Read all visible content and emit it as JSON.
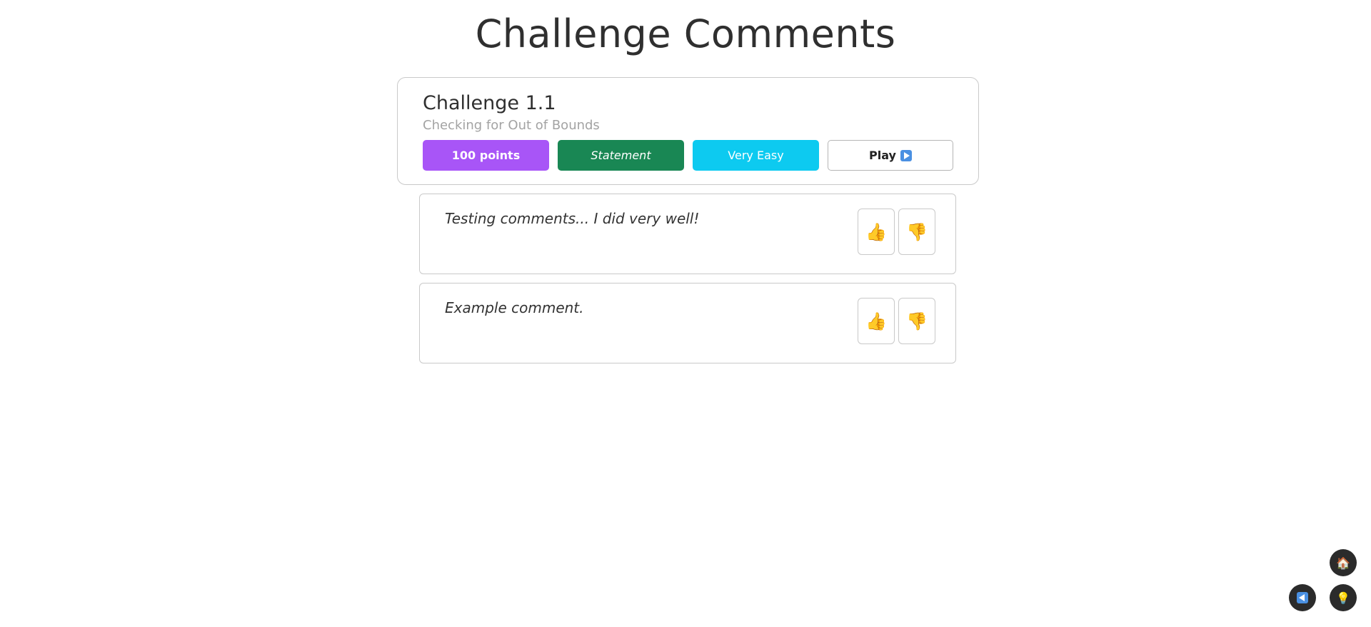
{
  "page": {
    "title": "Challenge Comments"
  },
  "challenge": {
    "name": "Challenge 1.1",
    "description": "Checking for Out of Bounds",
    "points_label": "100 points",
    "statement_label": "Statement",
    "difficulty_label": "Very Easy",
    "play_label": "Play"
  },
  "comments": [
    {
      "text": "Testing comments... I did very well!",
      "upvote_icon": "👍",
      "downvote_icon": "👎"
    },
    {
      "text": "Example comment.",
      "upvote_icon": "👍",
      "downvote_icon": "👎"
    }
  ],
  "floating_buttons": {
    "home_icon": "🏠",
    "hint_icon": "💡"
  },
  "colors": {
    "points": "#a855f7",
    "statement": "#198754",
    "difficulty": "#0dcaf0"
  }
}
